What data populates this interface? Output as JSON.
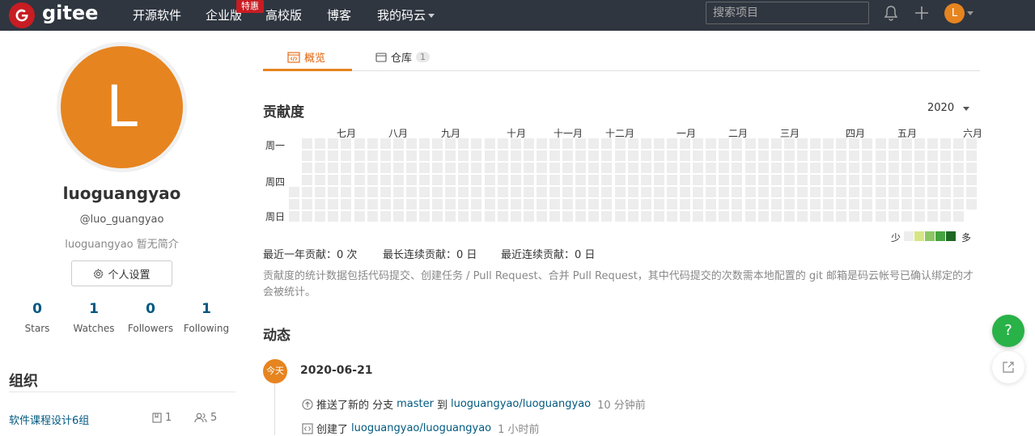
{
  "header": {
    "logo_text": "gitee",
    "logo_letter": "G",
    "nav": [
      "开源软件",
      "企业版",
      "高校版",
      "博客",
      "我的码云"
    ],
    "sale_badge": "特惠",
    "search_placeholder": "搜索项目",
    "avatar_letter": "L"
  },
  "profile": {
    "avatar_letter": "L",
    "username": "luoguangyao",
    "handle": "@luo_guangyao",
    "bio": "luoguangyao 暂无简介",
    "settings_label": "个人设置",
    "stats": [
      {
        "num": "0",
        "label": "Stars"
      },
      {
        "num": "1",
        "label": "Watches"
      },
      {
        "num": "0",
        "label": "Followers"
      },
      {
        "num": "1",
        "label": "Following"
      }
    ]
  },
  "orgs": {
    "title": "组织",
    "items": [
      {
        "name": "软件课程设计6组",
        "repos": "1",
        "members": "5"
      }
    ]
  },
  "tabs": [
    {
      "label": "概览"
    },
    {
      "label": "仓库",
      "count": "1"
    }
  ],
  "contrib": {
    "title": "贡献度",
    "year": "2020",
    "months": [
      "七月",
      "八月",
      "九月",
      "十月",
      "十一月",
      "十二月",
      "一月",
      "二月",
      "三月",
      "四月",
      "五月",
      "六月"
    ],
    "weekdays": [
      "周一",
      "周四",
      "周日"
    ],
    "legend_less": "少",
    "legend_more": "多",
    "legend_colors": [
      "#ededed",
      "#d6e685",
      "#8cc665",
      "#44a340",
      "#1e6823"
    ],
    "year_total": "最近一年贡献：0 次",
    "longest_streak": "最长连续贡献：0 日",
    "current_streak": "最近连续贡献：0 日",
    "note": "贡献度的统计数据包括代码提交、创建任务 / Pull Request、合并 Pull Request，其中代码提交的次数需本地配置的 git 邮箱是码云帐号已确认绑定的才会被统计。"
  },
  "feed": {
    "title": "动态",
    "today_label": "今天",
    "date": "2020-06-21",
    "items": [
      {
        "prefix": "推送了新的 分支",
        "branch": "master",
        "mid": "到",
        "repo": "luoguangyao/luoguangyao",
        "time": "10 分钟前"
      },
      {
        "prefix": "创建了",
        "repo": "luoguangyao/luoguangyao",
        "time": "1 小时前"
      }
    ]
  },
  "floating": {
    "help": "?"
  }
}
